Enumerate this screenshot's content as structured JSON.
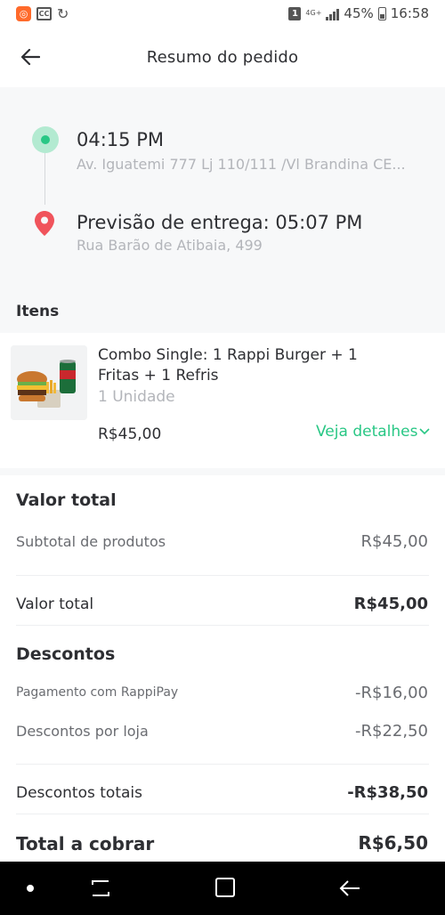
{
  "status_bar": {
    "network": "4G+",
    "battery": "45%",
    "time": "16:58",
    "notification_count": "1",
    "icons": [
      "app-notification-icon",
      "cc-icon",
      "refresh-icon",
      "signal-icon",
      "battery-icon"
    ]
  },
  "header": {
    "title": "Resumo do pedido",
    "back_icon": "arrow-left-icon"
  },
  "route": {
    "pickup_time": "04:15 PM",
    "pickup_address": "Av. Iguatemi 777 Lj 110/111 /Vl Brandina CE...",
    "delivery_title": "Previsão de entrega: 05:07 PM",
    "delivery_address": "Rua Barão de Atibaia, 499"
  },
  "items": {
    "title": "Itens",
    "list": [
      {
        "name": "Combo Single: 1 Rappi Burger + 1 Fritas + 1 Refris",
        "quantity": "1 Unidade",
        "price": "R$45,00",
        "details_link": "Veja detalhes"
      }
    ]
  },
  "totals": {
    "title": "Valor total",
    "subtotal_label": "Subtotal de produtos",
    "subtotal_value": "R$45,00",
    "total_label": "Valor total",
    "total_value": "R$45,00"
  },
  "discounts": {
    "title": "Descontos",
    "rows": [
      {
        "label": "Pagamento com RappiPay",
        "value": "-R$16,00"
      },
      {
        "label": "Descontos por loja",
        "value": "-R$22,50"
      }
    ],
    "total_label": "Descontos totais",
    "total_value": "-R$38,50"
  },
  "charge": {
    "label": "Total a cobrar",
    "value": "R$6,50"
  },
  "colors": {
    "accent_green": "#29c785",
    "pin_red": "#f0545c",
    "muted_text": "#b3b5ba",
    "section_bg": "#f7f8f9"
  }
}
